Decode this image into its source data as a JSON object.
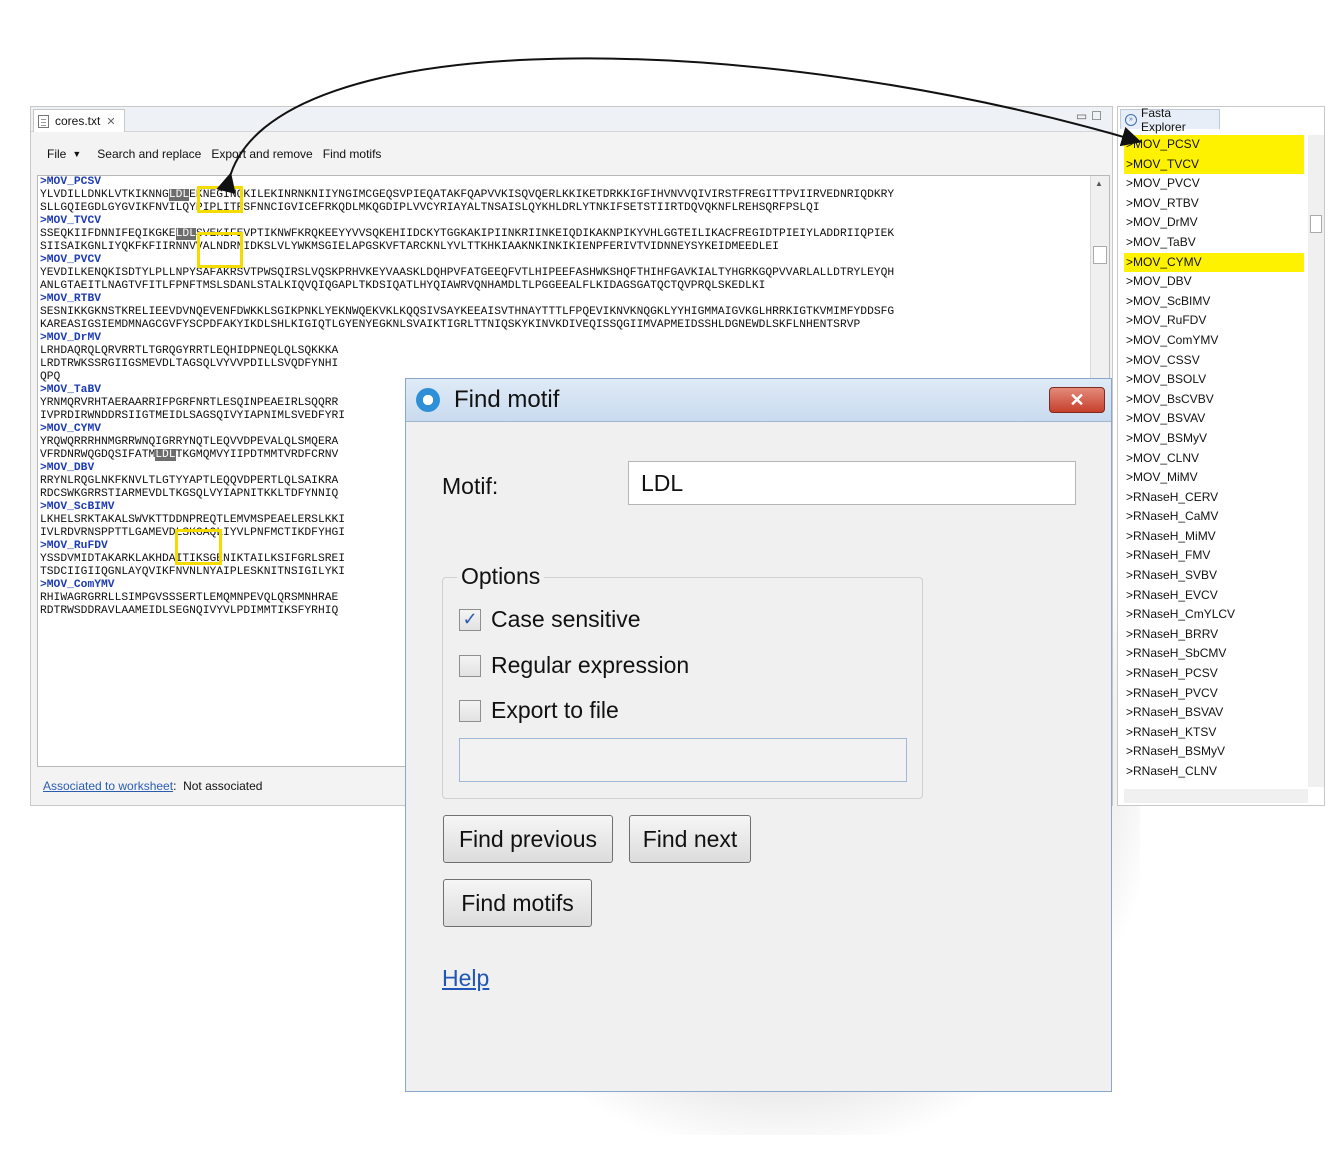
{
  "editor": {
    "tab_label": "cores.txt",
    "menu": {
      "file": "File",
      "search_replace": "Search and replace",
      "export_remove": "Export and remove",
      "find_motifs": "Find motifs"
    },
    "lines": [
      {
        "text": ">MOV_PCSV",
        "header": true
      },
      {
        "text": "YLVDILLDNKLVTKIKNNG",
        "hl": "LDL",
        "rest": "EKNEGINQKILEKINRNKNIIYNGIMCGEQSVPIEQATAKFQAPVVKISQVQERLKKIKETDRKKIGFIHVNVVQIVIRSTFREGITTPVIIRVEDNRIQDKRY"
      },
      {
        "text": "SLLGQIEGDLGYGVIKFNVILQYPIPLITRSFNNCIGVICEFRKQDLMKQGDIPLVVCYRIAYALTNSAISLQYKHLDRLYTNKIFSETSTIIRTDQVQKNFLREHSQRFPSLQI"
      },
      {
        "text": ">MOV_TVCV",
        "header": true
      },
      {
        "text": "SSEQKIIFDNNIFEQIKGKE",
        "hl": "LDL",
        "rest": "SVEKIFEVPTIKNWFKRQKEEYYVVSQKEHIIDCKYTGGKAKIPIINKRIINKEIQDIKAKNPIKYVHLGGTEILIKACFREGIDTPIEIYLADDRIIQPIEK"
      },
      {
        "text": "SIISAIKGNLIYQKFKFIIRNNVVALNDRNIDKSLVLYWKMSGIELAPGSKVFTARCKNLYVLTTKHKIAAKNKINKIKIENPFERIVTVIDNNEYSYKEIDMEEDLEI"
      },
      {
        "text": ">MOV_PVCV",
        "header": true
      },
      {
        "text": "YEVDILKENQKISDTYLPLLNPYSAFAKRSVTPWSQIRSLVQSKPRHVKEYVAASKLDQHPVFATGEEQFVTLHIPEEFASHWKSHQFTHIHFGAVKIALTYHGRKGQPVVARLALLDTRYLEYQH"
      },
      {
        "text": "ANLGTAEITLNAGTVFITLFPNFTMSLSDANLSTALKIQVQIQGAPLTKDSIQATLHYQIAWRVQNHAMDLTLPGGEEALFLKIDAGSGATQCTQVPRQLSKEDLKI"
      },
      {
        "text": ">MOV_RTBV",
        "header": true
      },
      {
        "text": "SESNIKKGKNSTKRELIEEVDVNQEVENFDWKKLSGIKPNKLYEKNWQEKVKLKQQSIVSAYKEEAISVTHNAYTTTLFPQEVIKNVKNQGKLYYHIGMMAIGVKGLHRRKIGTKVMIMFYDDSFG"
      },
      {
        "text": "KAREASIGSIEMDMNAGCGVFYSCPDFAKYIKDLSHLKIGIQTLGYENYEGKNLSVAIKTIGRLTTNIQSKYKINVKDIVEQISSQGIIMVAPMEIDSSHLDGNEWDLSKFLNHENTSRVP"
      },
      {
        "text": ">MOV_DrMV",
        "header": true
      },
      {
        "text": "LRHDAQRQLQRVRRTLTGRQGYRRTLEQHIDPNEQLQLSQKKKA"
      },
      {
        "text": "LRDTRWKSSRGIIGSMEVDLTAGSQLVYVVPDILLSVQDFYNHI"
      },
      {
        "text": "QPQ"
      },
      {
        "text": ">MOV_TaBV",
        "header": true
      },
      {
        "text": "YRNMQRVRHTAERAARRIFPGRFNRTLESQINPEAEIRLSQQRR"
      },
      {
        "text": "IVPRDIRWNDDRSIIGTMEIDLSAGSQIVYIAPNIMLSVEDFYRI"
      },
      {
        "text": ">MOV_CYMV",
        "header": true
      },
      {
        "text": "YRQWQRRRHNMGRRWNQIGRRYNQTLEQVVDPEVALQLSMQERA"
      },
      {
        "text": "VFRDNRWQGDQSIFATM",
        "hl": "LDL",
        "rest": "TKGMQMVYIIPDTMMTVRDFCRNV"
      },
      {
        "text": ">MOV_DBV",
        "header": true
      },
      {
        "text": "RRYNLRQGLNKFKNVLTLGTYYAPTLEQQVDPERTLQLSAIKRA"
      },
      {
        "text": "RDCSWKGRRSTIARMEVDLTKGSQLVYIAPNITKKLTDFYNNIQ"
      },
      {
        "text": ">MOV_ScBIMV",
        "header": true
      },
      {
        "text": "LKHELSRKTAKALSWVKTTDDNPREQTLEMVMSPEAELERSLKKI"
      },
      {
        "text": "IVLRDVRNSPPTTLGAMEVDLSKGAQLIYVLPNFMCTIKDFYHGI"
      },
      {
        "text": ">MOV_RuFDV",
        "header": true
      },
      {
        "text": "YSSDVMIDTAKARKLAKHDAITIKSGENIKTAILKSIFGRLSREI"
      },
      {
        "text": "TSDCIIGIIQGNLAYQVIKFNVNLNYAIPLESKNITNSIGILYKI"
      },
      {
        "text": ">MOV_ComYMV",
        "header": true
      },
      {
        "text": "RHIWAGRGRRLLSIMPGVSSSERTLEMQMNPEVQLQRSMNHRAE"
      },
      {
        "text": "RDTRWSDDRAVLAAMEIDLSEGNQIVYVLPDIMMTIKSFYRHIQ"
      }
    ],
    "status": {
      "link": "Associated to worksheet",
      "colon": ":",
      "value": "Not associated"
    }
  },
  "explorer": {
    "tab_label": "Fasta Explorer",
    "items": [
      {
        "label": ">MOV_PCSV",
        "selected": true
      },
      {
        "label": ">MOV_TVCV",
        "selected": true
      },
      {
        "label": ">MOV_PVCV",
        "selected": false
      },
      {
        "label": ">MOV_RTBV",
        "selected": false
      },
      {
        "label": ">MOV_DrMV",
        "selected": false
      },
      {
        "label": ">MOV_TaBV",
        "selected": false
      },
      {
        "label": ">MOV_CYMV",
        "selected": true
      },
      {
        "label": ">MOV_DBV",
        "selected": false
      },
      {
        "label": ">MOV_ScBIMV",
        "selected": false
      },
      {
        "label": ">MOV_RuFDV",
        "selected": false
      },
      {
        "label": ">MOV_ComYMV",
        "selected": false
      },
      {
        "label": ">MOV_CSSV",
        "selected": false
      },
      {
        "label": ">MOV_BSOLV",
        "selected": false
      },
      {
        "label": ">MOV_BsCVBV",
        "selected": false
      },
      {
        "label": ">MOV_BSVAV",
        "selected": false
      },
      {
        "label": ">MOV_BSMyV",
        "selected": false
      },
      {
        "label": ">MOV_CLNV",
        "selected": false
      },
      {
        "label": ">MOV_MiMV",
        "selected": false
      },
      {
        "label": ">RNaseH_CERV",
        "selected": false
      },
      {
        "label": ">RNaseH_CaMV",
        "selected": false
      },
      {
        "label": ">RNaseH_MiMV",
        "selected": false
      },
      {
        "label": ">RNaseH_FMV",
        "selected": false
      },
      {
        "label": ">RNaseH_SVBV",
        "selected": false
      },
      {
        "label": ">RNaseH_EVCV",
        "selected": false
      },
      {
        "label": ">RNaseH_CmYLCV",
        "selected": false
      },
      {
        "label": ">RNaseH_BRRV",
        "selected": false
      },
      {
        "label": ">RNaseH_SbCMV",
        "selected": false
      },
      {
        "label": ">RNaseH_PCSV",
        "selected": false
      },
      {
        "label": ">RNaseH_PVCV",
        "selected": false
      },
      {
        "label": ">RNaseH_BSVAV",
        "selected": false
      },
      {
        "label": ">RNaseH_KTSV",
        "selected": false
      },
      {
        "label": ">RNaseH_BSMyV",
        "selected": false
      },
      {
        "label": ">RNaseH_CLNV",
        "selected": false
      }
    ],
    "highlight_color": "#fff200"
  },
  "dialog": {
    "title": "Find motif",
    "close_glyph": "✕",
    "motif_label": "Motif:",
    "motif_value": "LDL",
    "options_legend": "Options",
    "case_sensitive": {
      "label": "Case sensitive",
      "checked": true
    },
    "regex": {
      "label": "Regular expression",
      "checked": false
    },
    "export": {
      "label": "Export to file",
      "checked": false
    },
    "export_path": "",
    "btn_prev": "Find previous",
    "btn_next": "Find next",
    "btn_motifs": "Find motifs",
    "help": "Help"
  },
  "colors": {
    "annotation_box": "#f5dc00",
    "sequence_header": "#1d3bb3",
    "match_highlight": "#6d6d6d"
  }
}
